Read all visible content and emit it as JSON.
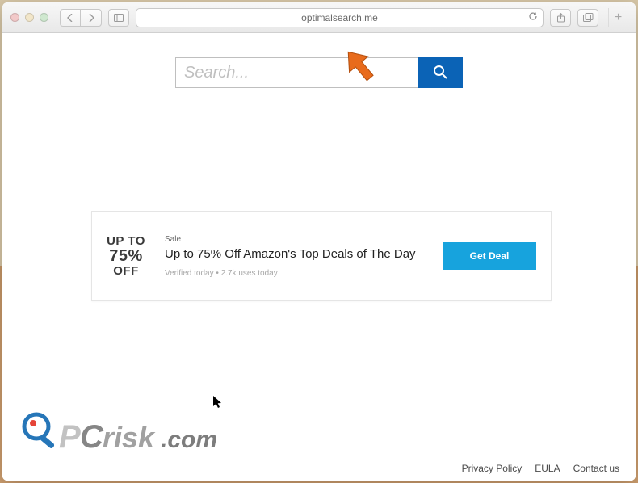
{
  "browser": {
    "url": "optimalsearch.me"
  },
  "search": {
    "placeholder": "Search...",
    "value": ""
  },
  "ad": {
    "promo_line1": "UP TO",
    "promo_pct": "75%",
    "promo_line3": "OFF",
    "category": "Sale",
    "title": "Up to 75% Off Amazon's Top Deals of The Day",
    "meta": "Verified today • 2.7k uses today",
    "cta": "Get Deal"
  },
  "footer": {
    "privacy": "Privacy Policy",
    "eula": "EULA",
    "contact": "Contact us"
  },
  "watermark": {
    "text": "PCrisk.com"
  }
}
